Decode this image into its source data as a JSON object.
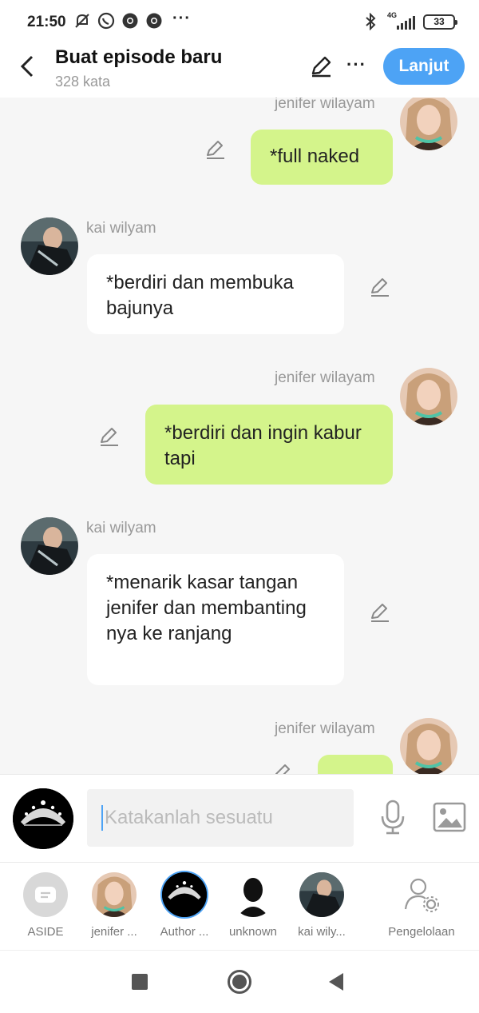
{
  "status_bar": {
    "time": "21:50",
    "network": "4G",
    "battery": "33"
  },
  "header": {
    "title": "Buat episode baru",
    "word_count": "328 kata",
    "next_label": "Lanjut"
  },
  "messages": [
    {
      "sender": "jenifer wilayam",
      "side": "right",
      "text": "*full naked"
    },
    {
      "sender": "kai wilyam",
      "side": "left",
      "text": "*berdiri dan membuka bajunya"
    },
    {
      "sender": "jenifer wilayam",
      "side": "right",
      "text": "*berdiri dan ingin kabur tapi"
    },
    {
      "sender": "kai wilyam",
      "side": "left",
      "text": "*menarik kasar tangan jenifer dan membanting nya ke ranjang"
    },
    {
      "sender": "jenifer wilayam",
      "side": "right",
      "text": ""
    }
  ],
  "composer": {
    "placeholder": "Katakanlah sesuatu"
  },
  "characters": [
    {
      "label": "ASIDE"
    },
    {
      "label": "jenifer ..."
    },
    {
      "label": "Author ..."
    },
    {
      "label": "unknown"
    },
    {
      "label": "kai wily..."
    },
    {
      "label": "Pengelolaan"
    }
  ],
  "colors": {
    "accent": "#4da3f5",
    "my_bubble": "#d4f48b",
    "their_bubble": "#ffffff"
  }
}
